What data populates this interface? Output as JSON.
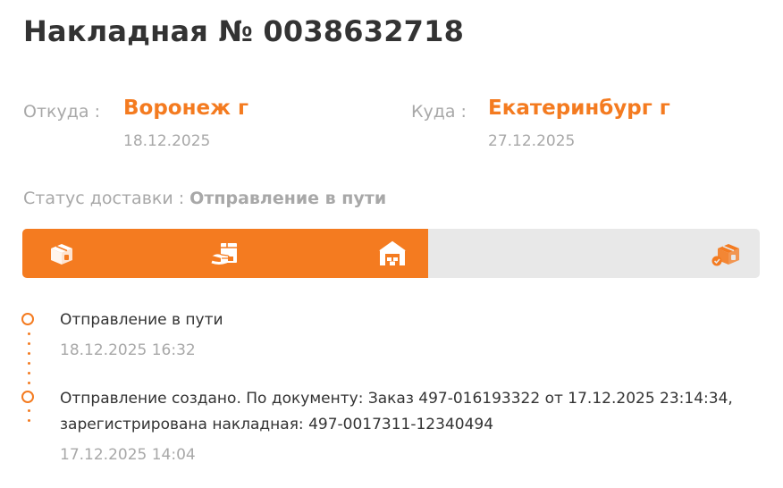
{
  "waybill": {
    "title": "Накладная № 0038632718"
  },
  "route": {
    "from_label": "Откуда :",
    "from_city": "Воронеж г",
    "from_date": "18.12.2025",
    "to_label": "Куда :",
    "to_city": "Екатеринбург г",
    "to_date": "27.12.2025"
  },
  "status": {
    "label": "Статус доставки :",
    "value": "Отправление в пути"
  },
  "progress": {
    "fraction_complete": 0.55,
    "accent_color": "#f47b20",
    "track_color": "#e8e8e8",
    "stages": [
      {
        "icon": "box-icon",
        "done": true
      },
      {
        "icon": "hand-package-icon",
        "done": true
      },
      {
        "icon": "warehouse-icon",
        "done": true
      },
      {
        "icon": "box-delivered-icon",
        "done": false
      }
    ]
  },
  "events": [
    {
      "text_line1": "Отправление в пути",
      "text_line2": "",
      "time": "18.12.2025 16:32"
    },
    {
      "text_line1": "Отправление создано. По документу: Заказ 497-016193322 от 17.12.2025 23:14:34,",
      "text_line2": "зарегистрирована накладная: 497-0017311-12340494",
      "time": "17.12.2025 14:04"
    }
  ]
}
